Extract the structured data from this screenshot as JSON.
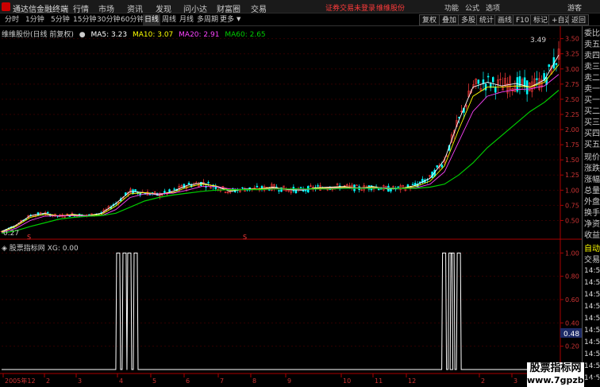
{
  "app": {
    "name": "通达信金融终端",
    "warning": "证券交易未登录",
    "stock_name": "维维股份",
    "guest": "游客"
  },
  "menus": [
    "行情",
    "市场",
    "资讯",
    "发现",
    "问小达",
    "财富圈",
    "交易"
  ],
  "right_menus": [
    "功能",
    "公式",
    "选项"
  ],
  "periods": [
    "分时",
    "1分钟",
    "5分钟",
    "15分钟",
    "30分钟",
    "60分钟",
    "日线",
    "周线",
    "月线",
    "多周期",
    "更多"
  ],
  "active_period": "日线",
  "tool_buttons": [
    "复权",
    "叠加",
    "多股",
    "统计",
    "画线",
    "F10",
    "标记",
    "+自选",
    "返回"
  ],
  "legend": {
    "title": "维维股份(日线 前复权)",
    "ma5": "MA5: 3.23",
    "ma10": "MA10: 3.07",
    "ma20": "MA20: 2.91",
    "ma60": "MA60: 2.65",
    "colors": {
      "ma5": "#ffffff",
      "ma10": "#ffff00",
      "ma20": "#ff44ff",
      "ma60": "#00cc00",
      "up": "#ff3b3b",
      "down": "#00ffff"
    }
  },
  "price_axis": [
    "3.50",
    "3.25",
    "3.00",
    "2.75",
    "2.50",
    "2.25",
    "2.00",
    "1.75",
    "1.50",
    "1.25",
    "1.00",
    "0.75",
    "0.50"
  ],
  "price_ylim": [
    0.27,
    3.6
  ],
  "annotations": {
    "high": "3.49",
    "low": "0.27"
  },
  "indicator": {
    "title": "股票指标网",
    "xg": "XG: 0.00",
    "axis": [
      "1.00",
      "0.80",
      "0.60",
      "0.40",
      "0.20"
    ],
    "current": "0.48"
  },
  "date_axis": [
    "2005年12",
    "2",
    "3",
    "4",
    "5",
    "6",
    "7",
    "8",
    "9",
    "10",
    "11",
    "12",
    "2",
    "3"
  ],
  "signal_markers": [
    "S",
    "S"
  ],
  "right_panel": {
    "labels": [
      "委比",
      "卖五",
      "卖四",
      "卖三",
      "卖二",
      "卖一",
      "买一",
      "买二",
      "买三",
      "买四",
      "买五",
      "现价",
      "涨跌",
      "涨幅",
      "总量",
      "外盘",
      "换手",
      "净资",
      "收益"
    ],
    "auto": "自动",
    "trade": "交易",
    "times": [
      "14:50",
      "14:50",
      "14:50",
      "14:50",
      "14:50",
      "14:50",
      "14:50",
      "14:50",
      "14:50",
      "14:50"
    ]
  },
  "watermark": {
    "line1": "股票指标网",
    "line2": "www.7gpzb.com"
  },
  "chart_data": {
    "type": "candlestick",
    "title": "维维股份(日线 前复权)",
    "ylim": [
      0.27,
      3.6
    ],
    "series": [
      {
        "name": "MA5",
        "values": [
          0.32,
          0.42,
          0.58,
          0.62,
          0.57,
          0.6,
          0.58,
          0.62,
          0.78,
          0.98,
          0.96,
          0.92,
          0.98,
          1.08,
          1.12,
          1.06,
          0.98,
          1.02,
          1.02,
          1.05,
          1.01,
          1.0,
          1.04,
          1.05,
          1.06,
          1.03,
          1.06,
          1.02,
          1.03,
          1.08,
          1.2,
          1.5,
          2.15,
          2.7,
          2.78,
          2.72,
          2.76,
          2.7,
          2.82,
          3.23
        ]
      },
      {
        "name": "MA10",
        "values": [
          0.31,
          0.4,
          0.55,
          0.6,
          0.58,
          0.59,
          0.58,
          0.6,
          0.74,
          0.94,
          0.96,
          0.94,
          0.96,
          1.05,
          1.1,
          1.07,
          1.0,
          1.01,
          1.02,
          1.04,
          1.02,
          1.01,
          1.03,
          1.04,
          1.05,
          1.04,
          1.05,
          1.03,
          1.03,
          1.06,
          1.15,
          1.4,
          2.0,
          2.55,
          2.7,
          2.7,
          2.72,
          2.7,
          2.78,
          3.07
        ]
      },
      {
        "name": "MA20",
        "values": [
          0.3,
          0.37,
          0.5,
          0.57,
          0.58,
          0.58,
          0.58,
          0.58,
          0.68,
          0.88,
          0.94,
          0.94,
          0.95,
          1.0,
          1.06,
          1.06,
          1.02,
          1.01,
          1.01,
          1.03,
          1.02,
          1.01,
          1.02,
          1.03,
          1.04,
          1.04,
          1.04,
          1.04,
          1.03,
          1.04,
          1.1,
          1.3,
          1.8,
          2.3,
          2.55,
          2.62,
          2.66,
          2.67,
          2.72,
          2.91
        ]
      },
      {
        "name": "MA60",
        "values": [
          0.29,
          0.33,
          0.4,
          0.46,
          0.52,
          0.55,
          0.57,
          0.58,
          0.62,
          0.72,
          0.82,
          0.88,
          0.92,
          0.95,
          0.98,
          1.0,
          1.01,
          1.01,
          1.01,
          1.02,
          1.02,
          1.02,
          1.02,
          1.02,
          1.03,
          1.03,
          1.03,
          1.03,
          1.03,
          1.03,
          1.05,
          1.1,
          1.25,
          1.45,
          1.7,
          1.9,
          2.1,
          2.3,
          2.45,
          2.65
        ]
      }
    ],
    "indicator_spikes": [
      0.215,
      0.235,
      0.8,
      0.815
    ],
    "indicator_ylim": [
      0,
      1.05
    ]
  }
}
